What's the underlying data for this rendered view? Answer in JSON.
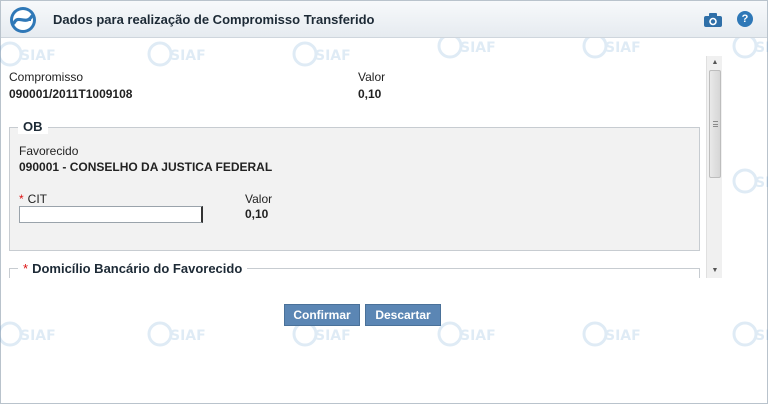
{
  "header": {
    "title": "Dados para realização de Compromisso Transferido",
    "icons": {
      "logo": "siafi-logo-icon",
      "camera": "camera-icon",
      "help": "help-icon"
    },
    "help_glyph": "?"
  },
  "summary": {
    "compromisso_label": "Compromisso",
    "compromisso_value": "090001/2011T1009108",
    "valor_label": "Valor",
    "valor_value": "0,10"
  },
  "ob": {
    "legend": "OB",
    "favorecido_label": "Favorecido",
    "favorecido_value": "090001 - CONSELHO DA JUSTICA FEDERAL",
    "cit_required_mark": "*",
    "cit_label": "CIT",
    "cit_value": "",
    "valor_label": "Valor",
    "valor_value": "0,10"
  },
  "domicilio": {
    "required_mark": "*",
    "legend": "Domicílio Bancário do Favorecido"
  },
  "actions": {
    "confirm_label": "Confirmar",
    "discard_label": "Descartar"
  },
  "watermark_text": "SIAFI",
  "colors": {
    "button_bg": "#5b86b4",
    "required": "#dd1111",
    "help_bg": "#2f78b7"
  }
}
